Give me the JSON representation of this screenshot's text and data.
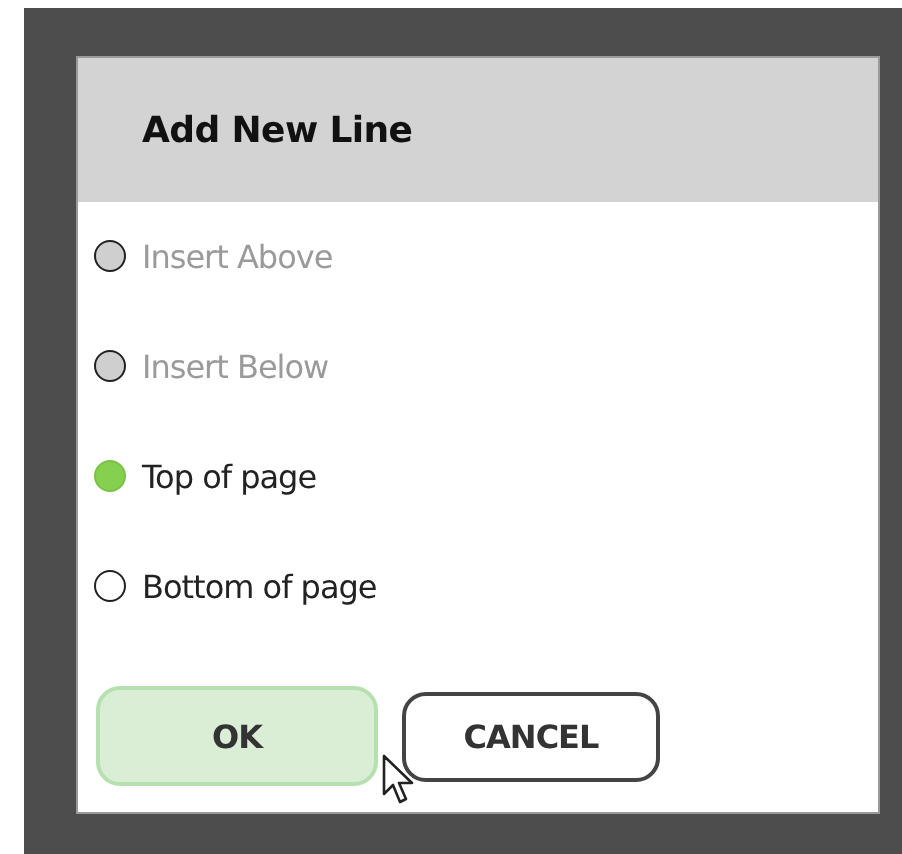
{
  "dialog": {
    "title": "Add New Line",
    "options": [
      {
        "label": "Insert Above",
        "selected": false,
        "disabled": true
      },
      {
        "label": "Insert Below",
        "selected": false,
        "disabled": true
      },
      {
        "label": "Top of page",
        "selected": true,
        "disabled": false
      },
      {
        "label": "Bottom of page",
        "selected": false,
        "disabled": false
      }
    ],
    "buttons": [
      {
        "label": "OK",
        "kind": "primary"
      },
      {
        "label": "CANCEL",
        "kind": "secondary"
      }
    ]
  }
}
